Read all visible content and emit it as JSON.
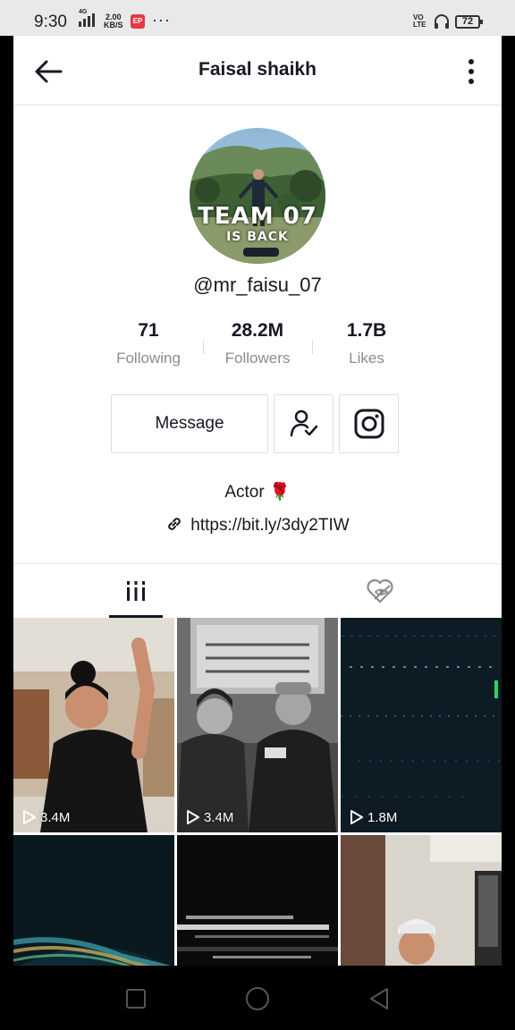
{
  "status_bar": {
    "time": "9:30",
    "network": "4G",
    "speed_value": "2.00",
    "speed_unit": "KB/S",
    "app_badge": "EP",
    "more": "···",
    "volte": "VO\nLTE",
    "battery": "72"
  },
  "header": {
    "title": "Faisal shaikh"
  },
  "profile": {
    "username": "@mr_faisu_07",
    "avatar_text_line1": "TEAM 07",
    "avatar_text_line2": "IS BACK",
    "stats": [
      {
        "value": "71",
        "label": "Following"
      },
      {
        "value": "28.2M",
        "label": "Followers"
      },
      {
        "value": "1.7B",
        "label": "Likes"
      }
    ],
    "message_label": "Message",
    "bio": "Actor 🌹",
    "link": "https://bit.ly/3dy2TIW"
  },
  "videos": [
    {
      "views": "3.4M"
    },
    {
      "views": "3.4M"
    },
    {
      "views": "1.8M"
    },
    {
      "views": ""
    },
    {
      "views": ""
    },
    {
      "views": ""
    }
  ],
  "colors": {
    "text_primary": "#161823",
    "text_secondary": "#8a8b91",
    "border": "#dedede"
  }
}
